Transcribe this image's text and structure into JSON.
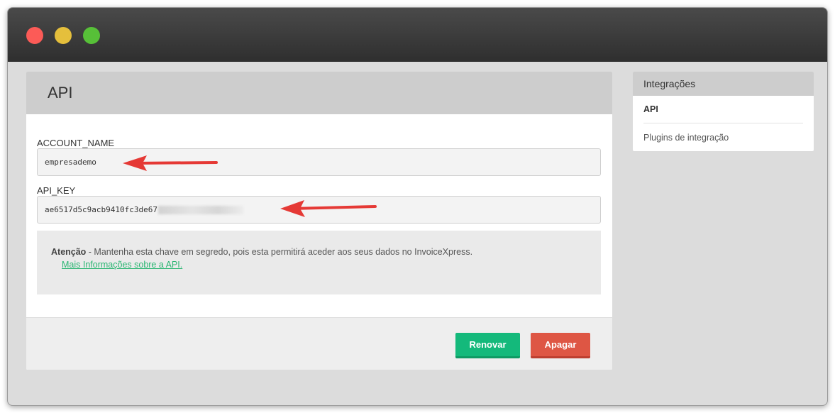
{
  "window": {
    "controls": [
      "close",
      "minimize",
      "zoom"
    ]
  },
  "main": {
    "title": "API",
    "account_name": {
      "label": "ACCOUNT_NAME",
      "value": "empresademo"
    },
    "api_key": {
      "label": "API_KEY",
      "value": "ae6517d5c9acb9410fc3de67"
    },
    "notice": {
      "strong": "Atenção",
      "text": " - Mantenha esta chave em segredo, pois esta permitirá aceder aos seus dados no InvoiceXpress.",
      "link": "Mais Informações sobre a API."
    },
    "buttons": {
      "renew": "Renovar",
      "delete": "Apagar"
    }
  },
  "sidebar": {
    "title": "Integrações",
    "items": [
      {
        "label": "API"
      },
      {
        "label": "Plugins de integração"
      }
    ]
  },
  "colors": {
    "renew": "#14b97b",
    "delete": "#de5644",
    "link": "#2bb673",
    "arrow": "#e53935"
  }
}
